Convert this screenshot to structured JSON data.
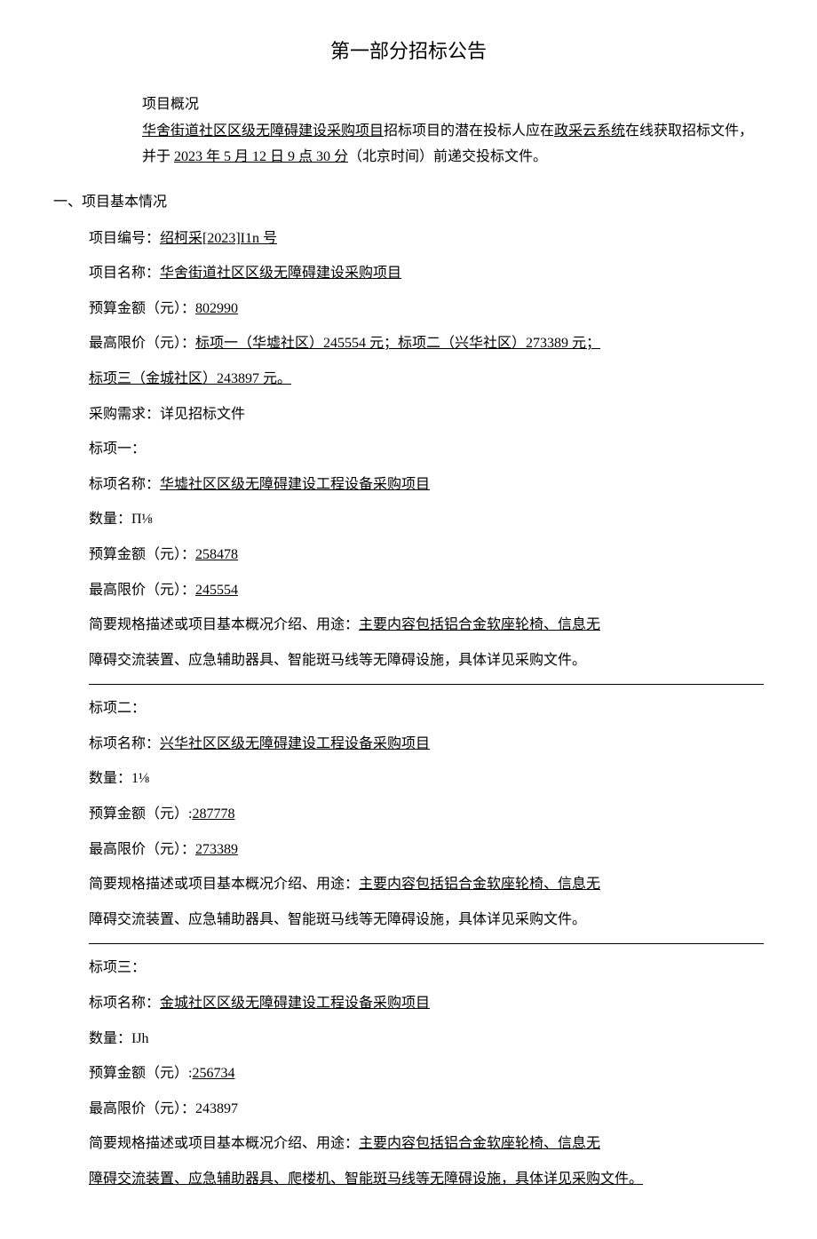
{
  "title": "第一部分招标公告",
  "overview": {
    "label": "项目概况",
    "line1_pre": "",
    "project_name_u": "华舍街道社区区级无障碍建设采购项目",
    "line1_mid": "招标项目的潜在投标人应在",
    "system_u": "政采云系统",
    "line1_post": "在线获取招标文件，",
    "line2_pre": "并于 ",
    "deadline_u": "2023 年 5 月 12 日 9 点 30 分",
    "line2_post": "（北京时间）前递交投标文件。"
  },
  "section1_heading": "一、项目基本情况",
  "fields": {
    "proj_no_label": "项目编号：",
    "proj_no_value": "绍柯采[2023]I1n 号",
    "proj_name_label": "项目名称：",
    "proj_name_value": "华舍街道社区区级无障碍建设采购项目",
    "budget_label": "预算金额（元）：",
    "budget_value": "802990",
    "ceiling_label": "最高限价（元）：",
    "ceiling_line1": "标项一（华墟社区）245554 元；标项二（兴华社区）273389 元；",
    "ceiling_line2": "标项三（金城社区）243897 元。",
    "req_label": "采购需求：详见招标文件"
  },
  "lots": [
    {
      "heading": "标项一：",
      "name_label": "标项名称：",
      "name_value": "华墟社区区级无障碍建设工程设备采购项目",
      "qty": "数量：Π⅛",
      "budget_label": "预算金额（元）：",
      "budget_value": "258478",
      "ceiling_label": "最高限价（元）：",
      "ceiling_value": "245554",
      "desc_label": "简要规格描述或项目基本概况介绍、用途：",
      "desc_u1": "主要内容包括铝合金软座轮椅、信息无",
      "desc_line2": "障碍交流装置、应急辅助器具、智能斑马线等无障碍设施，具体详见采购文件。"
    },
    {
      "heading": "标项二：",
      "name_label": "标项名称：",
      "name_value": "兴华社区区级无障碍建设工程设备采购项目",
      "qty": "数量：1⅛",
      "budget_label": "预算金额（元）:",
      "budget_value": "287778",
      "ceiling_label": "最高限价（元）：",
      "ceiling_value": "273389",
      "desc_label": "简要规格描述或项目基本概况介绍、用途：",
      "desc_u1": "主要内容包括铝合金软座轮椅、信息无",
      "desc_line2": "障碍交流装置、应急辅助器具、智能斑马线等无障碍设施，具体详见采购文件。"
    },
    {
      "heading": "标项三：",
      "name_label": "标项名称：",
      "name_value": "金城社区区级无障碍建设工程设备采购项目",
      "qty": "数量：IJh",
      "budget_label": "预算金额（元）:",
      "budget_value": "256734",
      "ceiling_label": "最高限价（元）：",
      "ceiling_value": "243897",
      "desc_label": "简要规格描述或项目基本概况介绍、用途：",
      "desc_u1": "主要内容包括铝合金软座轮椅、信息无",
      "desc_line2": "障碍交流装置、应急辅助器具、爬楼机、智能斑马线等无障碍设施，具体详见采购文件。"
    }
  ]
}
